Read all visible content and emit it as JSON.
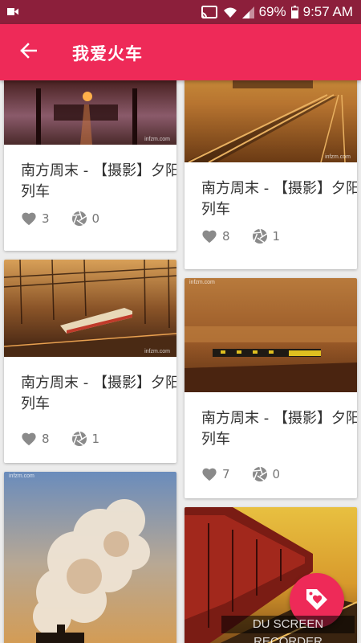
{
  "status_bar": {
    "battery": "69%",
    "time": "9:57 AM"
  },
  "app_bar": {
    "title": "我爱火车"
  },
  "cards": [
    {
      "title": "南方周末 - 【摄影】夕阳列车",
      "likes": "3",
      "shares": "0",
      "watermark": "infzm.com"
    },
    {
      "title": "南方周末 - 【摄影】夕阳列车",
      "likes": "8",
      "shares": "1",
      "watermark": "infzm.com"
    },
    {
      "title": "南方周末 - 【摄影】夕阳列车",
      "likes": "8",
      "shares": "1",
      "watermark": "infzm.com"
    },
    {
      "title": "南方周末 - 【摄影】夕阳列车",
      "likes": "7",
      "shares": "0",
      "watermark": "infzm.com"
    },
    {
      "title": "",
      "likes": "",
      "shares": "",
      "watermark": "infzm.com"
    },
    {
      "title": "",
      "likes": "",
      "shares": "",
      "watermark": ""
    }
  ],
  "recorder_watermark": "DU SCREEN RECORDER",
  "colors": {
    "status_bar": "#8c1f3b",
    "app_bar": "#ee2a58",
    "fab": "#ee2a58",
    "background": "#ececec"
  },
  "icons": {
    "back": "arrow-left-icon",
    "like": "heart-icon",
    "share": "aperture-icon",
    "fab": "heart-tag-icon"
  }
}
